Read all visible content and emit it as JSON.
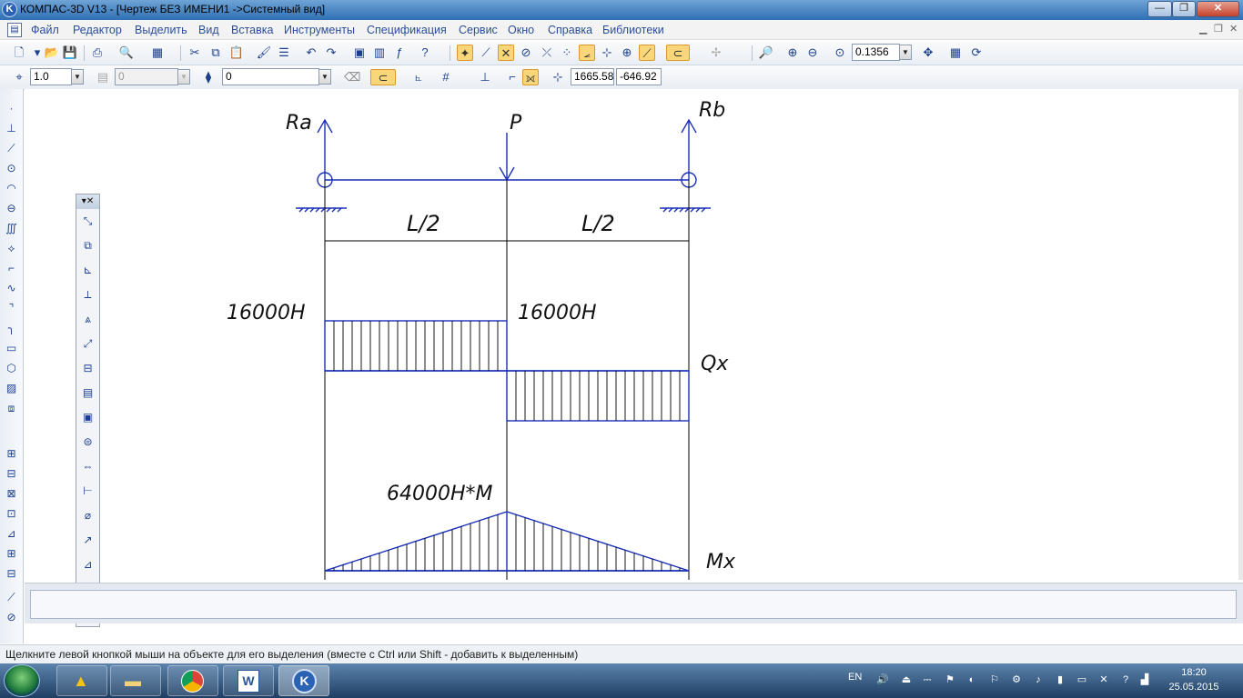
{
  "window": {
    "app_icon": "kompas-logo-icon",
    "title": "КОМПАС-3D V13 - [Чертеж БЕЗ ИМЕНИ1 ->Системный вид]"
  },
  "menu": {
    "items": [
      "Файл",
      "Редактор",
      "Выделить",
      "Вид",
      "Вставка",
      "Инструменты",
      "Спецификация",
      "Сервис",
      "Окно",
      "Справка",
      "Библиотеки"
    ]
  },
  "toolbar1": {
    "zoom_value": "0.1356"
  },
  "toolbar2": {
    "scale_value": "1.0",
    "layer_value": "0",
    "style_value": "0",
    "coord_x": "1665.58",
    "coord_y": "-646.92"
  },
  "drawing": {
    "label_ra": "Ra",
    "label_p": "P",
    "label_rb": "Rb",
    "label_l2_left": "L/2",
    "label_l2_right": "L/2",
    "label_q_left": "16000Н",
    "label_q_right": "16000Н",
    "label_qx": "Qx",
    "label_m_max": "64000Н*М",
    "label_mx": "Mx",
    "line_color": "#1a2fb8",
    "black_line_color": "#000000"
  },
  "status": {
    "hint": "Щелкните левой кнопкой мыши на объекте для его выделения (вместе с Ctrl или Shift - добавить к выделенным)"
  },
  "taskbar": {
    "language": "EN",
    "time": "18:20",
    "date": "25.05.2015"
  }
}
